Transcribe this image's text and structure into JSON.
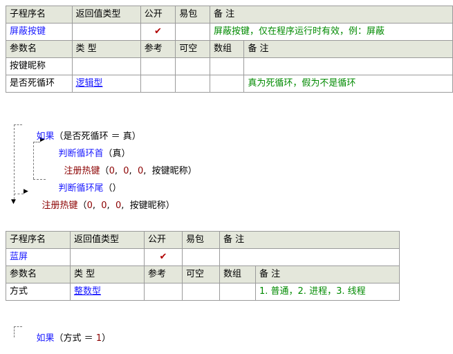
{
  "table1": {
    "header": [
      "子程序名",
      "返回值类型",
      "公开",
      "易包",
      "备 注"
    ],
    "row": {
      "name": "屏蔽按键",
      "ret": "",
      "public": "✔",
      "pkg": "",
      "note": "屏蔽按键，仅在程序运行时有效，例：屏蔽"
    },
    "param_header": [
      "参数名",
      "类 型",
      "参考",
      "可空",
      "数组",
      "备 注"
    ],
    "params": [
      {
        "name": "按键昵称",
        "type": "",
        "ref": "",
        "nullable": "",
        "array": "",
        "note": ""
      },
      {
        "name": "是否死循环",
        "type": "逻辑型",
        "ref": "",
        "nullable": "",
        "array": "",
        "note": "真为死循环，假为不是循环"
      }
    ]
  },
  "code1": {
    "if_line": {
      "kw": "如果",
      "cond": "（是否死循环 ＝ 真）"
    },
    "loop_head": {
      "kw": "判断循环首",
      "args": "（真）"
    },
    "reg1": {
      "fn": "注册热键",
      "args_open": "（",
      "a": "0",
      "b": "0",
      "c": "0",
      "d": "按键昵称",
      "args_close": "）"
    },
    "loop_tail": {
      "kw": "判断循环尾",
      "args": "（）"
    },
    "reg2": {
      "fn": "注册热键",
      "args_open": "（",
      "a": "0",
      "b": "0",
      "c": "0",
      "d": "按键昵称",
      "args_close": "）"
    }
  },
  "table2": {
    "header": [
      "子程序名",
      "返回值类型",
      "公开",
      "易包",
      "备 注"
    ],
    "row": {
      "name": "蓝屏",
      "ret": "",
      "public": "✔",
      "pkg": "",
      "note": ""
    },
    "param_header": [
      "参数名",
      "类 型",
      "参考",
      "可空",
      "数组",
      "备 注"
    ],
    "params": [
      {
        "name": "方式",
        "type": "整数型",
        "ref": "",
        "nullable": "",
        "array": "",
        "note": "1. 普通，2. 进程，3. 线程"
      }
    ]
  },
  "code2": {
    "if_line": {
      "kw": "如果",
      "cond_open": "（方式 ＝ ",
      "num": "1",
      "cond_close": "）"
    }
  }
}
